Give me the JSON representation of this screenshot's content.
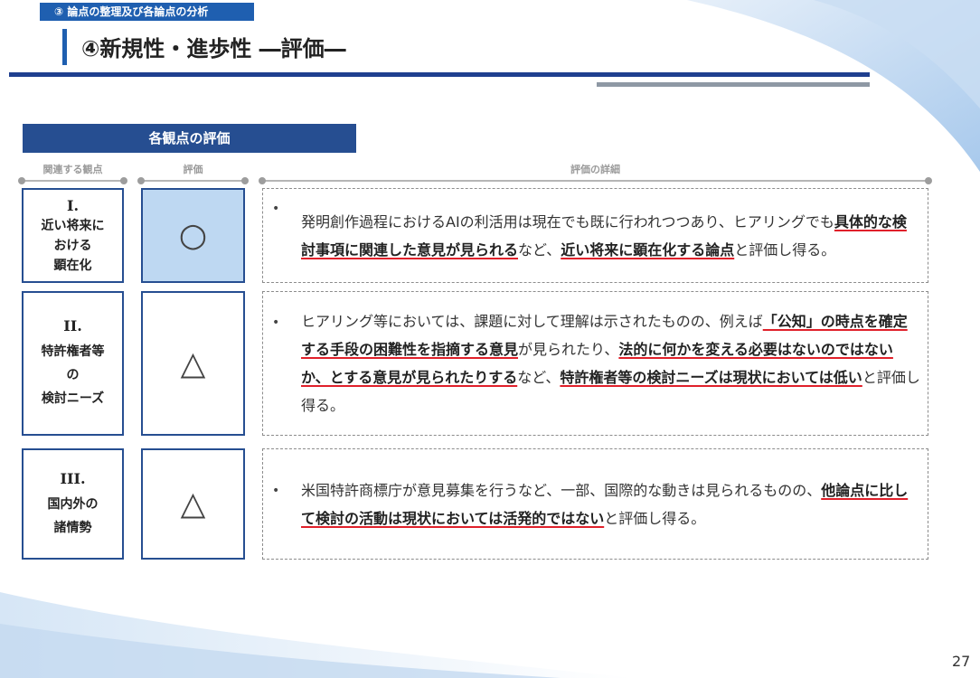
{
  "header": {
    "section_tag": "③ 論点の整理及び各論点の分析",
    "title": "④新規性・進歩性 ―評価―"
  },
  "panel": {
    "title": "各観点の評価",
    "columns": [
      "関連する観点",
      "評価",
      "評価の詳細"
    ]
  },
  "rows": [
    {
      "aspect_num": "I.",
      "aspect_lines": [
        "近い将来に",
        "おける",
        "顕在化"
      ],
      "rating": "○",
      "detail_segments": [
        {
          "t": "発明創作過程におけるAIの利活用は現在でも既に行われつつあり、ヒアリングでも"
        },
        {
          "t": "具体的な検討事項に関連した意見が見られる",
          "emph": true
        },
        {
          "t": "など、"
        },
        {
          "t": "近い将来に顕在化する論点",
          "emph": true
        },
        {
          "t": "と評価し得る。"
        }
      ]
    },
    {
      "aspect_num": "II.",
      "aspect_lines": [
        "特許権者等",
        "の",
        "検討ニーズ"
      ],
      "rating": "△",
      "detail_segments": [
        {
          "t": "ヒアリング等においては、課題に対して理解は示されたものの、例えば"
        },
        {
          "t": "「公知」の時点を確定する手段の困難性を指摘する意見",
          "emph": true
        },
        {
          "t": "が見られたり、"
        },
        {
          "t": "法的に何かを変える必要はないのではないか、とする意見が見られたりする",
          "emph": true
        },
        {
          "t": "など、"
        },
        {
          "t": "特許権者等の検討ニーズは現状においては低い",
          "emph": true
        },
        {
          "t": "と評価し得る。"
        }
      ]
    },
    {
      "aspect_num": "III.",
      "aspect_lines": [
        "国内外の",
        "諸情勢"
      ],
      "rating": "△",
      "detail_segments": [
        {
          "t": "米国特許商標庁が意見募集を行うなど、一部、国際的な動きは見られるものの、"
        },
        {
          "t": "他論点に比して検討の活動は現状においては活発的ではない",
          "emph": true
        },
        {
          "t": "と評価し得る。"
        }
      ]
    }
  ],
  "footer": {
    "page_number": "27"
  },
  "colors": {
    "accent": "#1f5fb0",
    "panel": "#264e91",
    "highlight": "#bed8f2",
    "underline": "#e0202a"
  }
}
